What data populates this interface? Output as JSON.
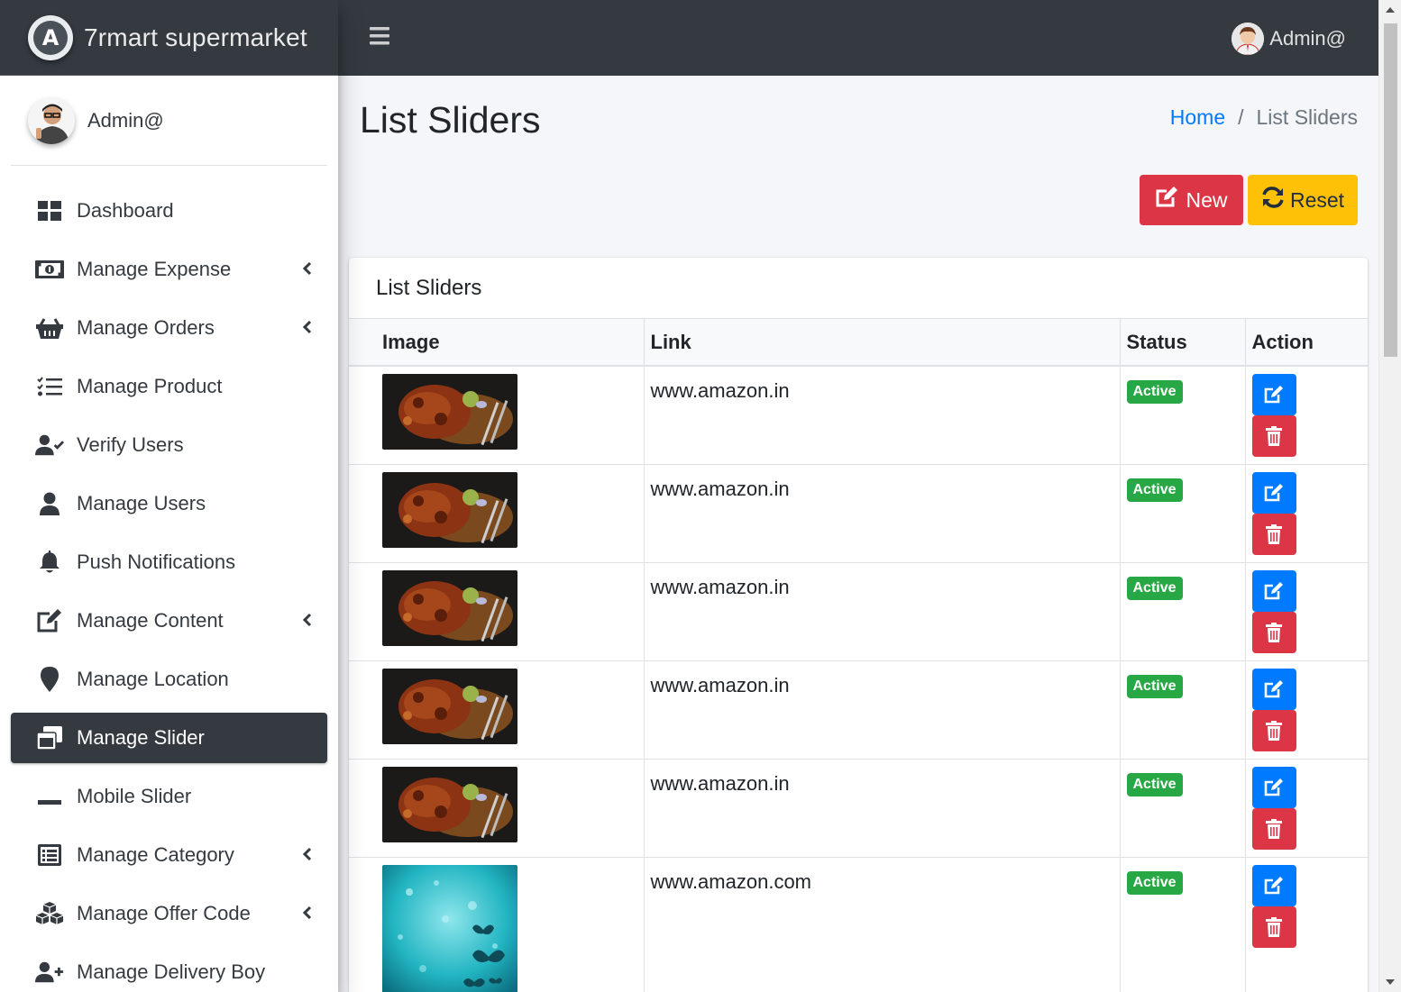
{
  "brand": {
    "name": "7rmart supermarket",
    "logo_letter": "A"
  },
  "sidebar": {
    "user_name": "Admin@",
    "items": [
      {
        "label": "Dashboard",
        "icon": "dashboard-icon",
        "caret": false,
        "active": false
      },
      {
        "label": "Manage Expense",
        "icon": "money-bill-icon",
        "caret": true,
        "active": false
      },
      {
        "label": "Manage Orders",
        "icon": "basket-icon",
        "caret": true,
        "active": false
      },
      {
        "label": "Manage Product",
        "icon": "tasks-list-icon",
        "caret": false,
        "active": false
      },
      {
        "label": "Verify Users",
        "icon": "user-check-icon",
        "caret": false,
        "active": false
      },
      {
        "label": "Manage Users",
        "icon": "user-icon",
        "caret": false,
        "active": false
      },
      {
        "label": "Push Notifications",
        "icon": "bell-icon",
        "caret": false,
        "active": false
      },
      {
        "label": "Manage Content",
        "icon": "edit-icon",
        "caret": true,
        "active": false
      },
      {
        "label": "Manage Location",
        "icon": "map-marker-icon",
        "caret": false,
        "active": false
      },
      {
        "label": "Manage Slider",
        "icon": "window-restore-icon",
        "caret": false,
        "active": true
      },
      {
        "label": "Mobile Slider",
        "icon": "minus-icon",
        "caret": false,
        "active": false
      },
      {
        "label": "Manage Category",
        "icon": "list-alt-icon",
        "caret": true,
        "active": false
      },
      {
        "label": "Manage Offer Code",
        "icon": "cubes-icon",
        "caret": true,
        "active": false
      },
      {
        "label": "Manage Delivery Boy",
        "icon": "user-plus-icon",
        "caret": false,
        "active": false
      }
    ]
  },
  "topbar": {
    "user_name": "Admin@"
  },
  "header": {
    "title": "List Sliders",
    "breadcrumb": {
      "home": "Home",
      "separator": "/",
      "current": "List Sliders"
    }
  },
  "actions": {
    "new_label": "New",
    "reset_label": "Reset"
  },
  "card": {
    "title": "List Sliders",
    "columns": [
      "Image",
      "Link",
      "Status",
      "Action"
    ],
    "rows": [
      {
        "image": "grilled-chicken",
        "link": "www.amazon.in",
        "status": "Active"
      },
      {
        "image": "grilled-chicken",
        "link": "www.amazon.in",
        "status": "Active"
      },
      {
        "image": "grilled-chicken",
        "link": "www.amazon.in",
        "status": "Active"
      },
      {
        "image": "grilled-chicken",
        "link": "www.amazon.in",
        "status": "Active"
      },
      {
        "image": "grilled-chicken",
        "link": "www.amazon.in",
        "status": "Active"
      },
      {
        "image": "butterflies-teal",
        "link": "www.amazon.com",
        "status": "Active"
      }
    ]
  },
  "colors": {
    "navbar": "#343a40",
    "primary": "#007bff",
    "danger": "#dc3545",
    "warning": "#ffc107",
    "success": "#28a745"
  }
}
